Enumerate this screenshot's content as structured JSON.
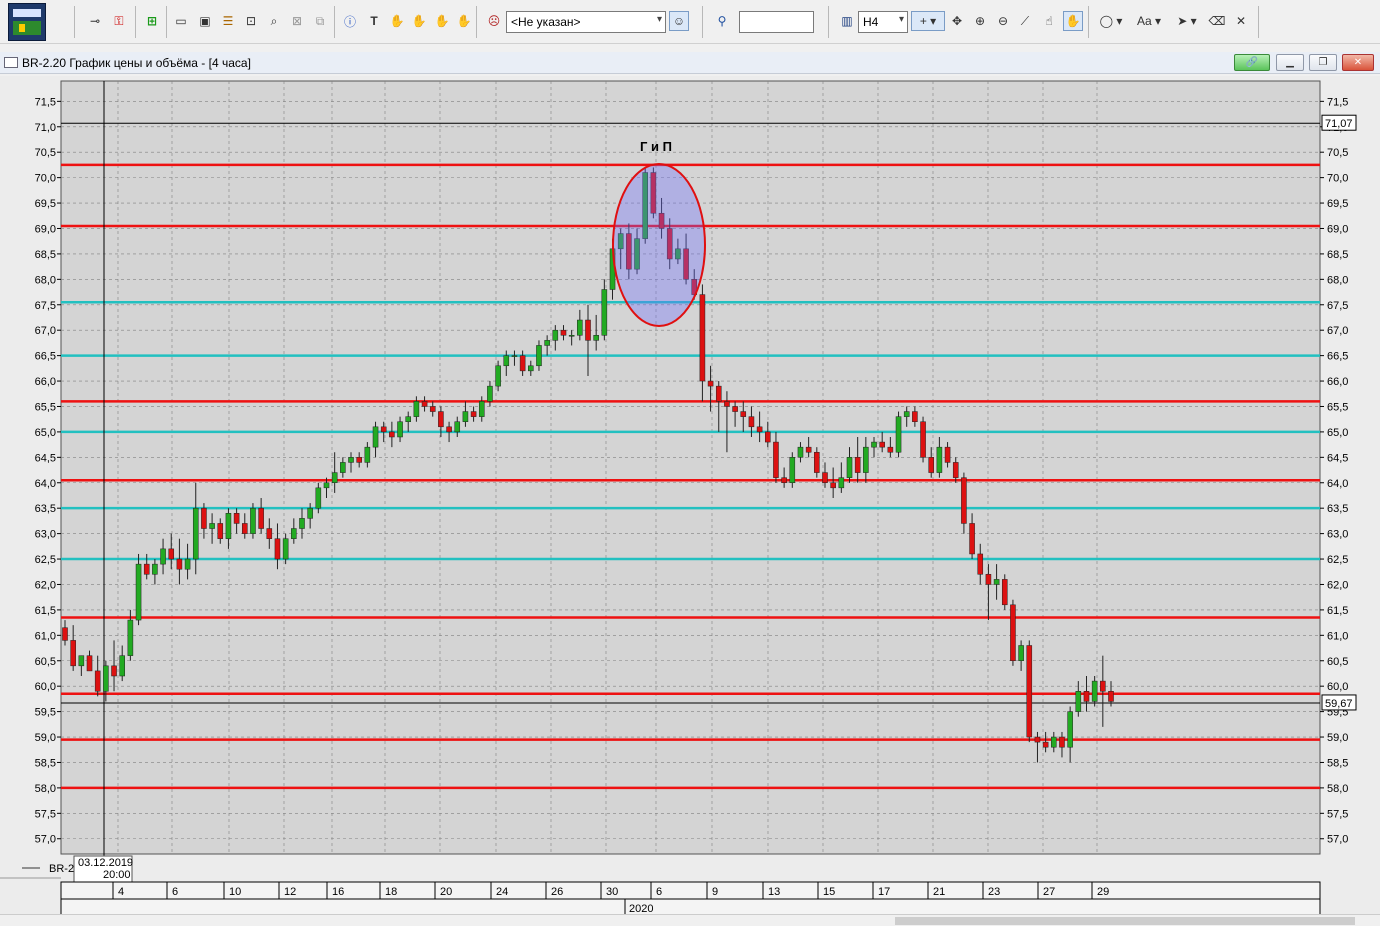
{
  "toolbar": {
    "account_combo": "<Не указан>",
    "search_value": "",
    "timeframe": "H4",
    "icons": [
      "logo-icon",
      "pin-icon",
      "key-icon",
      "add-icon",
      "chart-window-icon",
      "chart-window-2-icon",
      "list-icon",
      "zoom-window-icon",
      "search-window-icon",
      "close-window-icon",
      "copy-window-icon",
      "info-icon",
      "text-icon",
      "hand-icon",
      "hand-2-icon",
      "hand-3-icon",
      "hand-4-icon",
      "user-icon",
      "magnifier-icon",
      "bar-chart-icon",
      "crosshair-icon",
      "move-icon",
      "zoom-in-icon",
      "zoom-out-icon",
      "ruler-icon",
      "pointer-hand-icon",
      "grab-hand-icon",
      "ellipse-icon",
      "font-icon",
      "cursor-icon",
      "eraser-icon",
      "clear-icon"
    ]
  },
  "window": {
    "title": "BR-2.20 График цены и объёма - [4 часа]"
  },
  "chart_data": {
    "type": "candlestick",
    "title": "",
    "annotation": "Г и П",
    "ylim": [
      56.7,
      71.9
    ],
    "yticks": [
      "57,0",
      "57,5",
      "58,0",
      "58,5",
      "59,0",
      "59,5",
      "60,0",
      "60,5",
      "61,0",
      "61,5",
      "62,0",
      "62,5",
      "63,0",
      "63,5",
      "64,0",
      "64,5",
      "65,0",
      "65,5",
      "66,0",
      "66,5",
      "67,0",
      "67,5",
      "68,0",
      "68,5",
      "69,0",
      "69,5",
      "70,0",
      "70,5",
      "71,0",
      "71,5"
    ],
    "xticks": [
      "4",
      "6",
      "10",
      "12",
      "16",
      "18",
      "20",
      "24",
      "26",
      "30",
      "6",
      "9",
      "13",
      "15",
      "17",
      "21",
      "23",
      "27",
      "29"
    ],
    "year_label": "2020",
    "cursor_date": "03.12.2019",
    "cursor_time": "20:00",
    "series_label": "BR-2",
    "last_price_label": "59,67",
    "last_price": 59.67,
    "crosshair_price_label": "71,07",
    "crosshair_price": 71.07,
    "red_levels": [
      70.25,
      69.05,
      65.6,
      64.05,
      61.35,
      59.85,
      58.95,
      58.0
    ],
    "cyan_levels": [
      67.55,
      66.5,
      65.0,
      63.5,
      62.5
    ],
    "colors": {
      "up": "#22aa22",
      "down": "#dd1111",
      "red_line": "#ee1111",
      "cyan_line": "#22c0c0",
      "grid": "#808080",
      "bg": "#d4d4d4"
    },
    "candles": [
      [
        61.15,
        61.3,
        60.8,
        60.9
      ],
      [
        60.9,
        61.2,
        60.3,
        60.4
      ],
      [
        60.4,
        60.6,
        60.2,
        60.6
      ],
      [
        60.6,
        60.7,
        60.3,
        60.3
      ],
      [
        60.3,
        60.6,
        59.8,
        59.9
      ],
      [
        59.9,
        60.5,
        59.7,
        60.4
      ],
      [
        60.4,
        60.9,
        59.9,
        60.2
      ],
      [
        60.2,
        60.8,
        60.1,
        60.6
      ],
      [
        60.6,
        61.5,
        60.5,
        61.3
      ],
      [
        61.3,
        62.6,
        61.2,
        62.4
      ],
      [
        62.4,
        62.6,
        62.1,
        62.2
      ],
      [
        62.2,
        62.5,
        62.0,
        62.4
      ],
      [
        62.4,
        62.9,
        62.2,
        62.7
      ],
      [
        62.7,
        63.0,
        62.3,
        62.5
      ],
      [
        62.5,
        62.9,
        62.0,
        62.3
      ],
      [
        62.3,
        62.8,
        62.1,
        62.5
      ],
      [
        62.5,
        64.0,
        62.2,
        63.5
      ],
      [
        63.5,
        63.6,
        62.9,
        63.1
      ],
      [
        63.1,
        63.4,
        62.8,
        63.2
      ],
      [
        63.2,
        63.3,
        62.8,
        62.9
      ],
      [
        62.9,
        63.5,
        62.7,
        63.4
      ],
      [
        63.4,
        63.5,
        63.0,
        63.2
      ],
      [
        63.2,
        63.4,
        62.9,
        63.0
      ],
      [
        63.0,
        63.6,
        62.9,
        63.5
      ],
      [
        63.5,
        63.7,
        63.0,
        63.1
      ],
      [
        63.1,
        63.3,
        62.7,
        62.9
      ],
      [
        62.9,
        63.2,
        62.3,
        62.5
      ],
      [
        62.5,
        63.0,
        62.4,
        62.9
      ],
      [
        62.9,
        63.3,
        62.8,
        63.1
      ],
      [
        63.1,
        63.5,
        62.9,
        63.3
      ],
      [
        63.3,
        63.6,
        63.1,
        63.5
      ],
      [
        63.5,
        64.0,
        63.4,
        63.9
      ],
      [
        63.9,
        64.1,
        63.7,
        64.0
      ],
      [
        64.0,
        64.6,
        63.8,
        64.2
      ],
      [
        64.2,
        64.5,
        64.1,
        64.4
      ],
      [
        64.4,
        64.6,
        64.2,
        64.5
      ],
      [
        64.5,
        64.6,
        64.3,
        64.4
      ],
      [
        64.4,
        64.8,
        64.3,
        64.7
      ],
      [
        64.7,
        65.2,
        64.5,
        65.1
      ],
      [
        65.1,
        65.2,
        64.8,
        65.0
      ],
      [
        65.0,
        65.2,
        64.7,
        64.9
      ],
      [
        64.9,
        65.3,
        64.8,
        65.2
      ],
      [
        65.2,
        65.4,
        65.0,
        65.3
      ],
      [
        65.3,
        65.7,
        65.2,
        65.6
      ],
      [
        65.6,
        65.7,
        65.4,
        65.5
      ],
      [
        65.5,
        65.6,
        65.3,
        65.4
      ],
      [
        65.4,
        65.5,
        64.9,
        65.1
      ],
      [
        65.1,
        65.2,
        64.8,
        65.0
      ],
      [
        65.0,
        65.3,
        64.9,
        65.2
      ],
      [
        65.2,
        65.6,
        65.1,
        65.4
      ],
      [
        65.4,
        65.5,
        65.2,
        65.3
      ],
      [
        65.3,
        65.7,
        65.2,
        65.6
      ],
      [
        65.6,
        66.0,
        65.5,
        65.9
      ],
      [
        65.9,
        66.4,
        65.8,
        66.3
      ],
      [
        66.3,
        66.6,
        66.1,
        66.5
      ],
      [
        66.5,
        66.6,
        66.3,
        66.5
      ],
      [
        66.5,
        66.6,
        66.1,
        66.2
      ],
      [
        66.2,
        66.4,
        66.1,
        66.3
      ],
      [
        66.3,
        66.8,
        66.2,
        66.7
      ],
      [
        66.7,
        66.9,
        66.5,
        66.8
      ],
      [
        66.8,
        67.1,
        66.6,
        67.0
      ],
      [
        67.0,
        67.1,
        66.8,
        66.9
      ],
      [
        66.9,
        67.0,
        66.7,
        66.9
      ],
      [
        66.9,
        67.4,
        66.8,
        67.2
      ],
      [
        67.2,
        67.5,
        66.1,
        66.8
      ],
      [
        66.8,
        67.3,
        66.6,
        66.9
      ],
      [
        66.9,
        68.0,
        66.8,
        67.8
      ],
      [
        67.8,
        68.8,
        67.6,
        68.6
      ],
      [
        68.6,
        69.0,
        68.2,
        68.9
      ],
      [
        68.9,
        69.1,
        68.0,
        68.2
      ],
      [
        68.2,
        69.0,
        68.1,
        68.8
      ],
      [
        68.8,
        70.2,
        68.7,
        70.1
      ],
      [
        70.1,
        70.2,
        69.2,
        69.3
      ],
      [
        69.3,
        69.6,
        68.8,
        69.0
      ],
      [
        69.0,
        69.2,
        68.2,
        68.4
      ],
      [
        68.4,
        68.8,
        68.3,
        68.6
      ],
      [
        68.6,
        68.9,
        67.9,
        68.0
      ],
      [
        68.0,
        68.2,
        67.6,
        67.7
      ],
      [
        67.7,
        67.9,
        65.6,
        66.0
      ],
      [
        66.0,
        66.3,
        65.4,
        65.9
      ],
      [
        65.9,
        66.0,
        65.0,
        65.6
      ],
      [
        65.6,
        65.8,
        64.6,
        65.5
      ],
      [
        65.5,
        65.6,
        65.1,
        65.4
      ],
      [
        65.4,
        65.6,
        65.0,
        65.3
      ],
      [
        65.3,
        65.5,
        64.9,
        65.1
      ],
      [
        65.1,
        65.4,
        64.8,
        65.0
      ],
      [
        65.0,
        65.2,
        64.7,
        64.8
      ],
      [
        64.8,
        65.0,
        64.0,
        64.1
      ],
      [
        64.1,
        64.3,
        63.9,
        64.0
      ],
      [
        64.0,
        64.6,
        63.9,
        64.5
      ],
      [
        64.5,
        64.8,
        64.4,
        64.7
      ],
      [
        64.7,
        64.9,
        64.5,
        64.6
      ],
      [
        64.6,
        64.7,
        64.1,
        64.2
      ],
      [
        64.2,
        64.4,
        63.9,
        64.0
      ],
      [
        64.0,
        64.3,
        63.7,
        63.9
      ],
      [
        63.9,
        64.4,
        63.8,
        64.1
      ],
      [
        64.1,
        64.7,
        64.0,
        64.5
      ],
      [
        64.5,
        64.9,
        64.0,
        64.2
      ],
      [
        64.2,
        64.9,
        64.0,
        64.7
      ],
      [
        64.7,
        64.9,
        64.5,
        64.8
      ],
      [
        64.8,
        65.0,
        64.6,
        64.7
      ],
      [
        64.7,
        64.9,
        64.5,
        64.6
      ],
      [
        64.6,
        65.4,
        64.5,
        65.3
      ],
      [
        65.3,
        65.5,
        65.1,
        65.4
      ],
      [
        65.4,
        65.5,
        65.1,
        65.2
      ],
      [
        65.2,
        65.3,
        64.4,
        64.5
      ],
      [
        64.5,
        64.7,
        64.1,
        64.2
      ],
      [
        64.2,
        64.9,
        64.1,
        64.7
      ],
      [
        64.7,
        64.8,
        64.3,
        64.4
      ],
      [
        64.4,
        64.5,
        64.0,
        64.1
      ],
      [
        64.1,
        64.2,
        63.0,
        63.2
      ],
      [
        63.2,
        63.4,
        62.5,
        62.6
      ],
      [
        62.6,
        62.8,
        62.0,
        62.2
      ],
      [
        62.2,
        62.4,
        61.3,
        62.0
      ],
      [
        62.0,
        62.4,
        61.7,
        62.1
      ],
      [
        62.1,
        62.2,
        61.5,
        61.6
      ],
      [
        61.6,
        61.7,
        60.4,
        60.5
      ],
      [
        60.5,
        60.9,
        60.3,
        60.8
      ],
      [
        60.8,
        60.9,
        58.9,
        59.0
      ],
      [
        59.0,
        59.1,
        58.5,
        58.9
      ],
      [
        58.9,
        59.1,
        58.7,
        58.8
      ],
      [
        58.8,
        59.1,
        58.7,
        59.0
      ],
      [
        59.0,
        59.1,
        58.6,
        58.8
      ],
      [
        58.8,
        59.6,
        58.5,
        59.5
      ],
      [
        59.5,
        60.1,
        59.4,
        59.9
      ],
      [
        59.9,
        60.2,
        59.5,
        59.7
      ],
      [
        59.7,
        60.2,
        59.6,
        60.1
      ],
      [
        60.1,
        60.6,
        59.2,
        59.9
      ],
      [
        59.9,
        60.1,
        59.6,
        59.7
      ]
    ]
  }
}
